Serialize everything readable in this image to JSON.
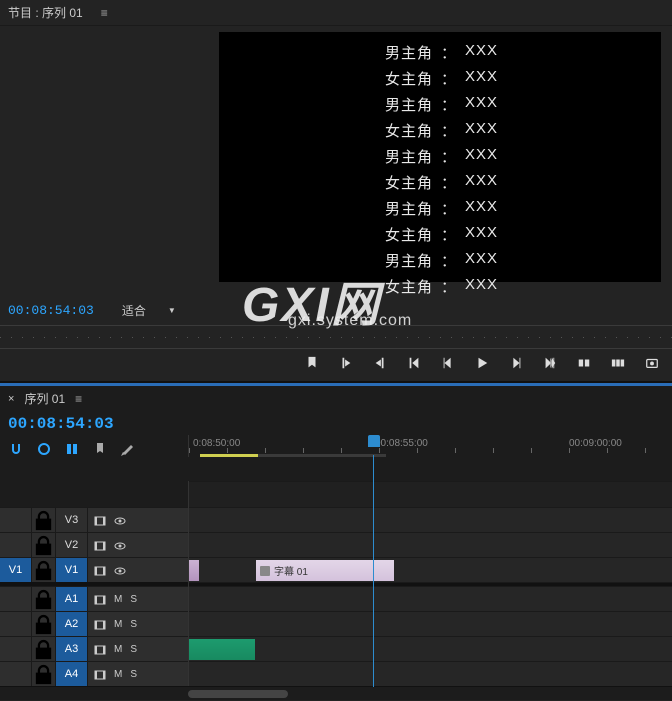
{
  "program": {
    "panel_title": "节目 : 序列 01",
    "timecode": "00:08:54:03",
    "fit_label": "适合",
    "credits": [
      {
        "role": "男主角",
        "name": "XXX"
      },
      {
        "role": "女主角",
        "name": "XXX"
      },
      {
        "role": "男主角",
        "name": "XXX"
      },
      {
        "role": "女主角",
        "name": "XXX"
      },
      {
        "role": "男主角",
        "name": "XXX"
      },
      {
        "role": "女主角",
        "name": "XXX"
      },
      {
        "role": "男主角",
        "name": "XXX"
      },
      {
        "role": "女主角",
        "name": "XXX"
      },
      {
        "role": "男主角",
        "name": "XXX"
      },
      {
        "role": "女主角",
        "name": "XXX"
      }
    ]
  },
  "timeline": {
    "seq_name": "序列 01",
    "timecode": "00:08:54:03",
    "ruler": [
      "0:08:50:00",
      "00:08:55:00",
      "00:09:00:00"
    ],
    "ruler_positions": [
      4,
      186,
      380
    ],
    "tracks_v": [
      {
        "src": "",
        "label": "V3",
        "active": false
      },
      {
        "src": "",
        "label": "V2",
        "active": false
      },
      {
        "src": "V1",
        "label": "V1",
        "active": true
      }
    ],
    "tracks_a": [
      {
        "src": "",
        "label": "A1",
        "active": true
      },
      {
        "src": "",
        "label": "A2",
        "active": true
      },
      {
        "src": "",
        "label": "A3",
        "active": true
      },
      {
        "src": "",
        "label": "A4",
        "active": true
      }
    ],
    "v1_clip_label": "字幕 01",
    "audio_letters": {
      "m": "M",
      "s": "S"
    }
  },
  "watermark": {
    "main": "GXI网",
    "sub": "gxi.system.com"
  },
  "icons": {
    "lock": "lock-icon",
    "eye": "eye-icon",
    "film": "film-icon"
  }
}
